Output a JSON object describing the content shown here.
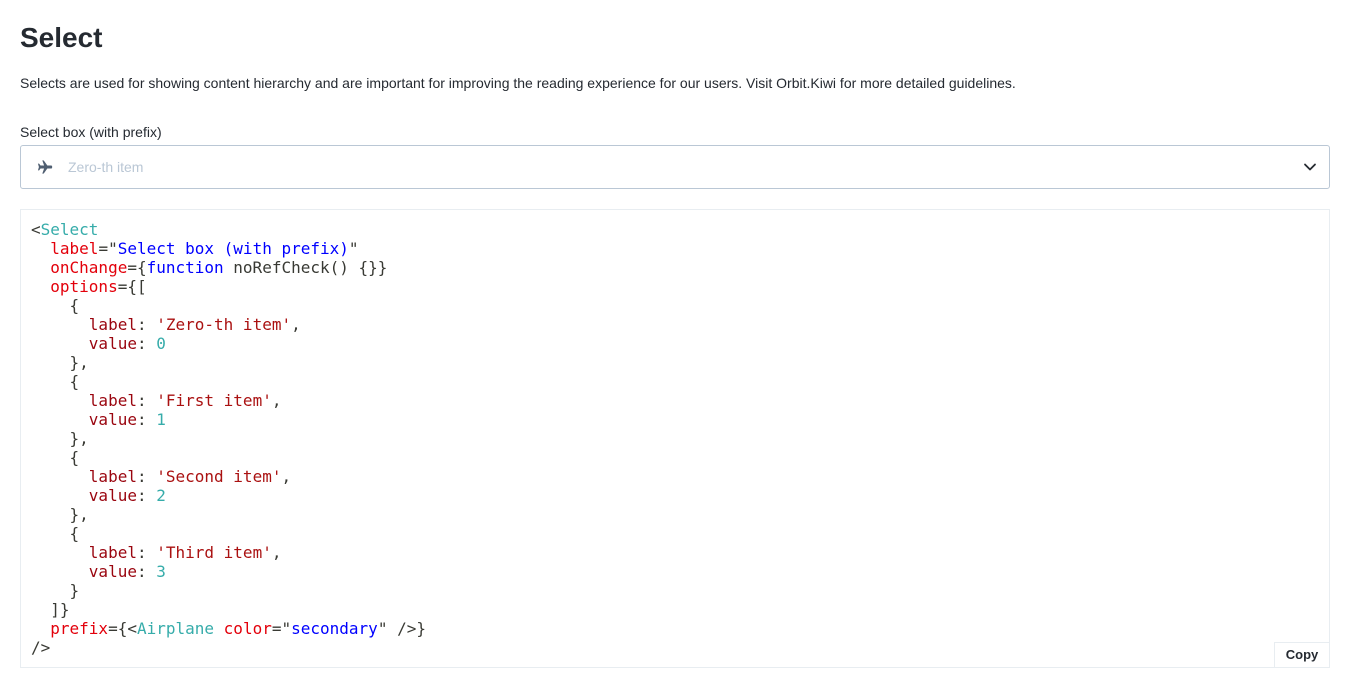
{
  "page": {
    "title": "Select",
    "description": "Selects are used for showing content hierarchy and are important for improving the reading experience for our users. Visit Orbit.Kiwi for more detailed guidelines."
  },
  "select": {
    "label": "Select box (with prefix)",
    "selected_value": "Zero-th item",
    "prefix_icon": "airplane-icon",
    "dropdown_icon": "chevron-down-icon"
  },
  "code": {
    "tag_open": "Select",
    "label_attr": "label",
    "label_value": "Select box (with prefix)",
    "onchange_attr": "onChange",
    "onchange_keyword": "function",
    "onchange_body": " noRefCheck() {}",
    "options_attr": "options",
    "option_key_label": "label",
    "option_key_value": "value",
    "options": [
      {
        "label": "'Zero-th item'",
        "value": "0"
      },
      {
        "label": "'First item'",
        "value": "1"
      },
      {
        "label": "'Second item'",
        "value": "2"
      },
      {
        "label": "'Third item'",
        "value": "3"
      }
    ],
    "prefix_attr": "prefix",
    "prefix_tag": "Airplane",
    "prefix_color_attr": "color",
    "prefix_color_value": "secondary",
    "copy_label": "Copy"
  },
  "colors": {
    "text": "#252a31",
    "border": "#bac7d5",
    "placeholder": "#bac7d5",
    "code_tag": "#36acaa",
    "code_attr": "#e3000b",
    "code_string": "#0000ff",
    "code_key": "#9a050f",
    "code_number": "#36acaa"
  }
}
